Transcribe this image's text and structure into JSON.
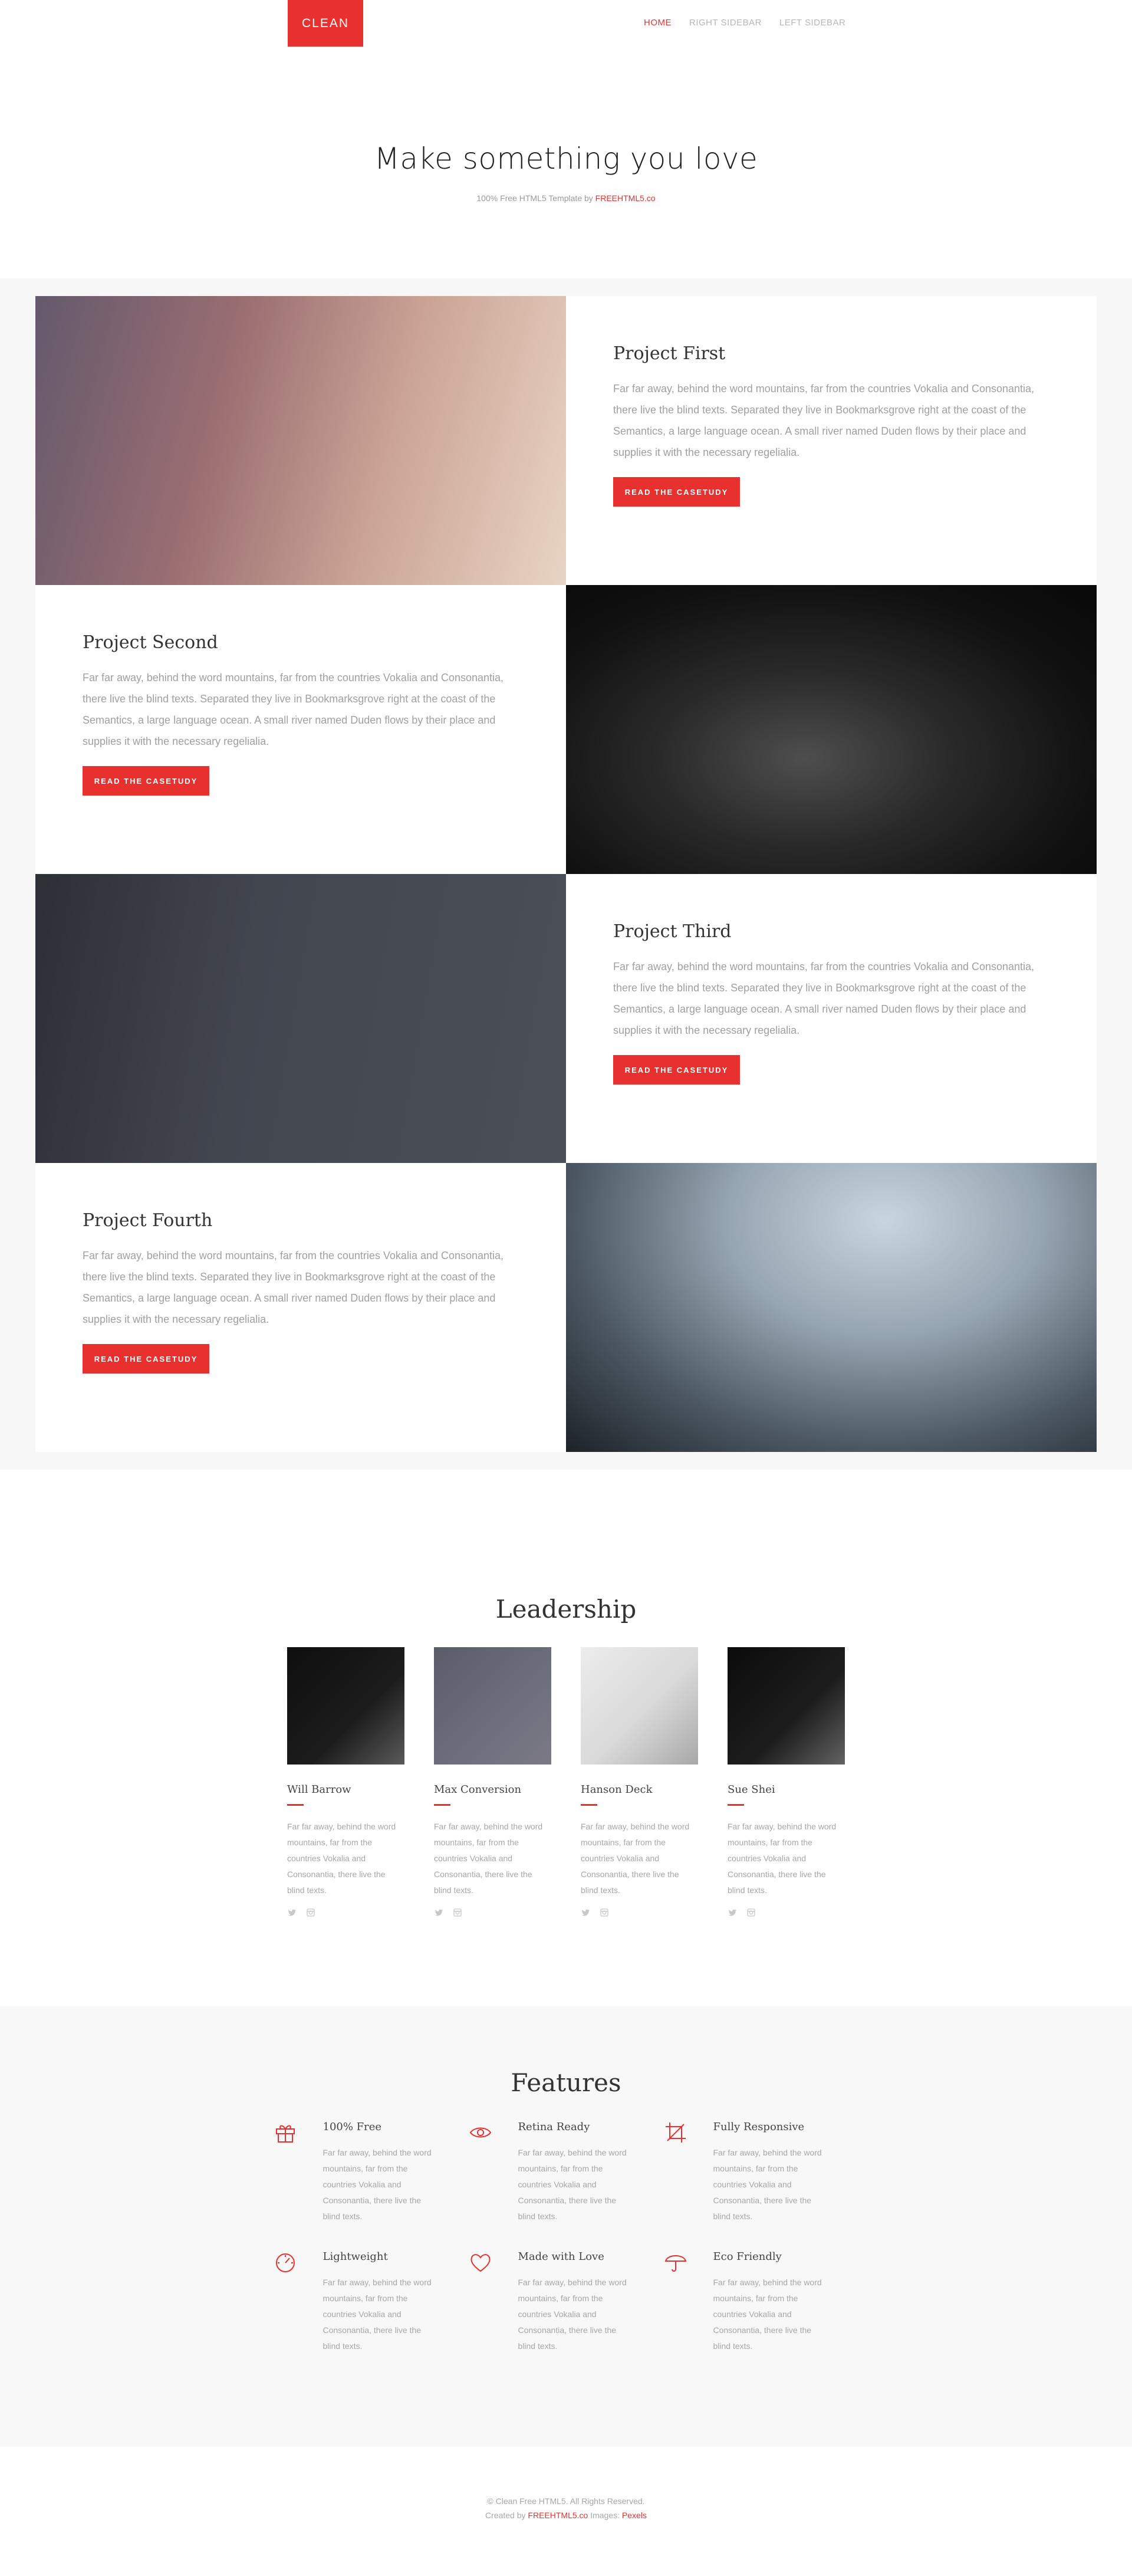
{
  "header": {
    "logo": "CLEAN",
    "nav": [
      {
        "label": "HOME",
        "active": true
      },
      {
        "label": "RIGHT SIDEBAR",
        "active": false
      },
      {
        "label": "LEFT SIDEBAR",
        "active": false
      }
    ]
  },
  "hero": {
    "title": "Make something you love",
    "subtitle_prefix": "100% Free HTML5 Template by ",
    "subtitle_link": "FREEHTML5.co"
  },
  "projects": [
    {
      "title": "Project First",
      "text": "Far far away, behind the word mountains, far from the countries Vokalia and Consonantia, there live the blind texts. Separated they live in Bookmarksgrove right at the coast of the Semantics, a large language ocean. A small river named Duden flows by their place and supplies it with the necessary regelialia.",
      "button": "READ THE CASETUDY"
    },
    {
      "title": "Project Second",
      "text": "Far far away, behind the word mountains, far from the countries Vokalia and Consonantia, there live the blind texts. Separated they live in Bookmarksgrove right at the coast of the Semantics, a large language ocean. A small river named Duden flows by their place and supplies it with the necessary regelialia.",
      "button": "READ THE CASETUDY"
    },
    {
      "title": "Project Third",
      "text": "Far far away, behind the word mountains, far from the countries Vokalia and Consonantia, there live the blind texts. Separated they live in Bookmarksgrove right at the coast of the Semantics, a large language ocean. A small river named Duden flows by their place and supplies it with the necessary regelialia.",
      "button": "READ THE CASETUDY"
    },
    {
      "title": "Project Fourth",
      "text": "Far far away, behind the word mountains, far from the countries Vokalia and Consonantia, there live the blind texts. Separated they live in Bookmarksgrove right at the coast of the Semantics, a large language ocean. A small river named Duden flows by their place and supplies it with the necessary regelialia.",
      "button": "READ THE CASETUDY"
    }
  ],
  "leadership": {
    "title": "Leadership",
    "members": [
      {
        "name": "Will Barrow",
        "bio": "Far far away, behind the word mountains, far from the countries Vokalia and Consonantia, there live the blind texts."
      },
      {
        "name": "Max Conversion",
        "bio": "Far far away, behind the word mountains, far from the countries Vokalia and Consonantia, there live the blind texts."
      },
      {
        "name": "Hanson Deck",
        "bio": "Far far away, behind the word mountains, far from the countries Vokalia and Consonantia, there live the blind texts."
      },
      {
        "name": "Sue Shei",
        "bio": "Far far away, behind the word mountains, far from the countries Vokalia and Consonantia, there live the blind texts."
      }
    ]
  },
  "features": {
    "title": "Features",
    "items": [
      {
        "title": "100% Free",
        "icon": "gift-icon",
        "text": "Far far away, behind the word mountains, far from the countries Vokalia and Consonantia, there live the blind texts."
      },
      {
        "title": "Retina Ready",
        "icon": "eye-icon",
        "text": "Far far away, behind the word mountains, far from the countries Vokalia and Consonantia, there live the blind texts."
      },
      {
        "title": "Fully Responsive",
        "icon": "crop-icon",
        "text": "Far far away, behind the word mountains, far from the countries Vokalia and Consonantia, there live the blind texts."
      },
      {
        "title": "Lightweight",
        "icon": "speedometer-icon",
        "text": "Far far away, behind the word mountains, far from the countries Vokalia and Consonantia, there live the blind texts."
      },
      {
        "title": "Made with Love",
        "icon": "heart-icon",
        "text": "Far far away, behind the word mountains, far from the countries Vokalia and Consonantia, there live the blind texts."
      },
      {
        "title": "Eco Friendly",
        "icon": "umbrella-icon",
        "text": "Far far away, behind the word mountains, far from the countries Vokalia and Consonantia, there live the blind texts."
      }
    ]
  },
  "footer": {
    "line1": "© Clean Free HTML5. All Rights Reserved.",
    "line2_prefix": "Created by ",
    "line2_link1": "FREEHTML5.co",
    "line2_mid": " Images: ",
    "line2_link2": "Pexels"
  },
  "colors": {
    "accent": "#e8312f",
    "muted_text": "#a7a7a7",
    "section_bg": "#f8f8f8"
  }
}
